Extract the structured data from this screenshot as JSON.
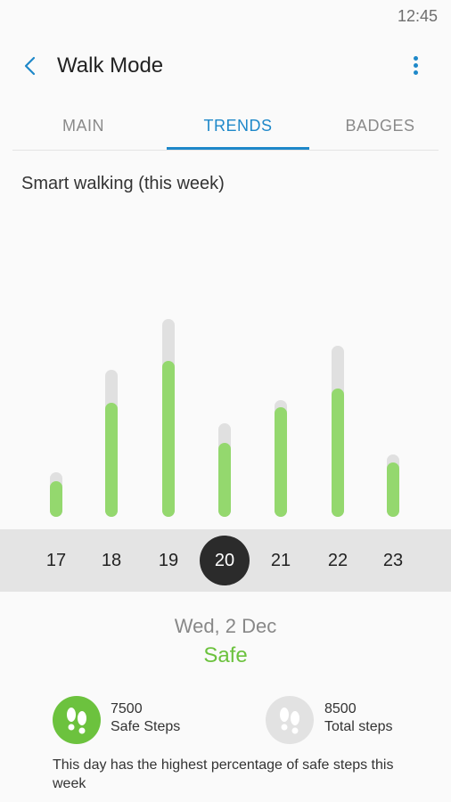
{
  "status_bar": {
    "time": "12:45"
  },
  "header": {
    "title": "Walk Mode"
  },
  "tabs": [
    {
      "label": "MAIN",
      "active": false
    },
    {
      "label": "TRENDS",
      "active": true
    },
    {
      "label": "BADGES",
      "active": false
    }
  ],
  "section_title": "Smart walking (this week)",
  "chart_data": {
    "type": "bar",
    "categories": [
      "17",
      "18",
      "19",
      "20",
      "21",
      "22",
      "23"
    ],
    "series": [
      {
        "values": [
          50,
          165,
          222,
          105,
          131,
          192,
          70
        ]
      },
      {
        "values": [
          40,
          128,
          175,
          83,
          123,
          144,
          61
        ]
      }
    ],
    "selected": "20",
    "colors": {
      "total": "#e0e0e0",
      "safe": "#94d86e"
    }
  },
  "selected_day": {
    "date": "Wed, 2 Dec",
    "status": "Safe"
  },
  "stats": {
    "safe": {
      "value": "7500",
      "label": "Safe Steps"
    },
    "total": {
      "value": "8500",
      "label": "Total steps"
    }
  },
  "note": "This day has the highest percentage of safe steps this week",
  "colors": {
    "accent": "#1e88c9",
    "safe_green": "#6cc23e",
    "icon_grey": "#e2e2e2"
  }
}
